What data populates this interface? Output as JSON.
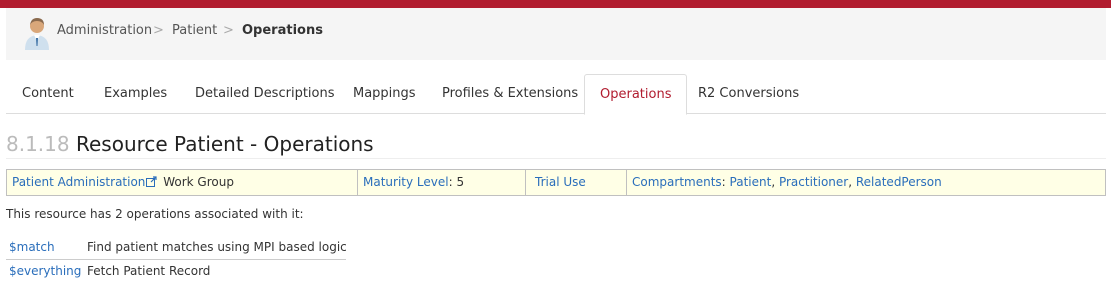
{
  "breadcrumb": {
    "items": [
      "Administration",
      "Patient",
      "Operations"
    ],
    "separator": ">"
  },
  "tabs": [
    {
      "label": "Content"
    },
    {
      "label": "Examples"
    },
    {
      "label": "Detailed Descriptions"
    },
    {
      "label": "Mappings"
    },
    {
      "label": "Profiles & Extensions"
    },
    {
      "label": "Operations",
      "active": true
    },
    {
      "label": "R2 Conversions"
    }
  ],
  "title": {
    "number": "8.1.18",
    "text": "Resource Patient - Operations"
  },
  "info": {
    "workgroup_link": "Patient Administration",
    "workgroup_suffix": "Work Group",
    "maturity_label": "Maturity Level",
    "maturity_value": ": 5",
    "standards_status": "Trial Use",
    "compartments_label": "Compartments",
    "compartments": [
      "Patient",
      "Practitioner",
      "RelatedPerson"
    ]
  },
  "intro": "This resource has 2 operations associated with it:",
  "operations": [
    {
      "name": "$match",
      "description": "Find patient matches using MPI based logic"
    },
    {
      "name": "$everything",
      "description": "Fetch Patient Record"
    }
  ],
  "colors": {
    "brand": "#b11c2f",
    "link": "#2a6ebb",
    "info_bg": "#ffffe6"
  },
  "icons": {
    "avatar": "user-avatar-icon",
    "external": "external-link-icon"
  }
}
